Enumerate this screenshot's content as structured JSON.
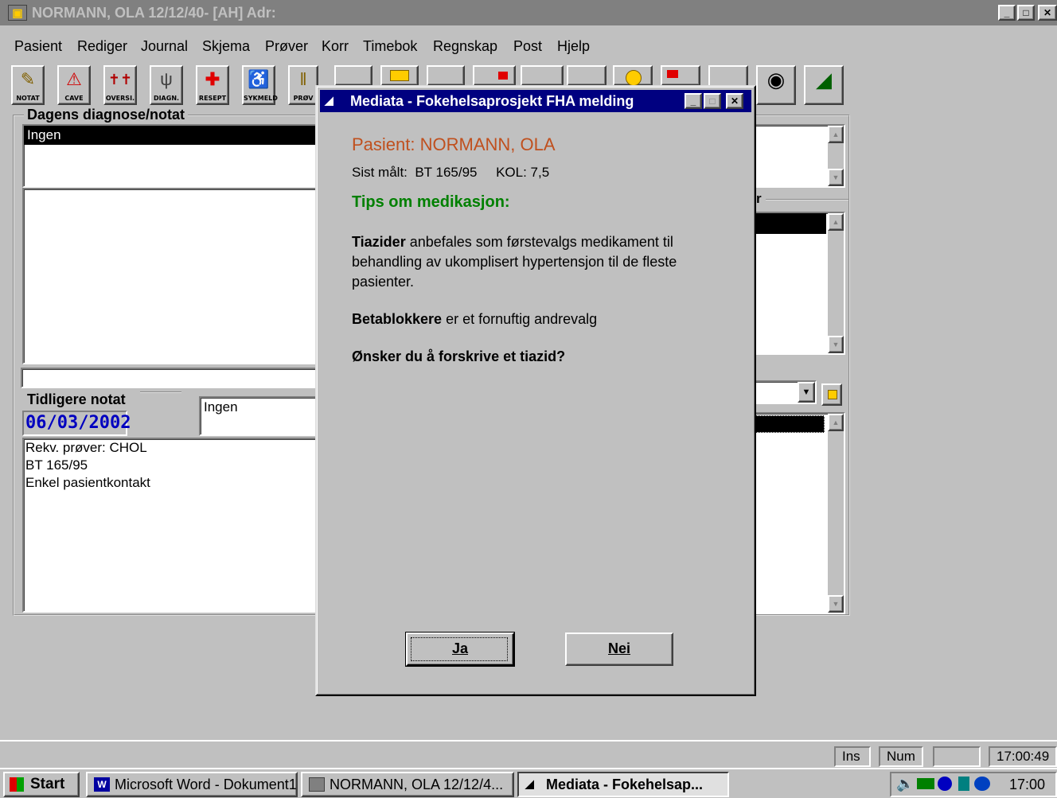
{
  "main_window": {
    "title": "NORMANN, OLA 12/12/40- [AH] Adr:",
    "controls": [
      "_",
      "□",
      "✕"
    ]
  },
  "menu": {
    "items": [
      "Pasient",
      "Rediger",
      "Journal",
      "Skjema",
      "Prøver",
      "Korr",
      "Timebok",
      "Regnskap",
      "Post",
      "Hjelp"
    ]
  },
  "toolbar": {
    "buttons": [
      {
        "label": "NOTAT",
        "icon": "notepad-icon"
      },
      {
        "label": "CAVE",
        "icon": "warning-icon"
      },
      {
        "label": "OVERSI.",
        "icon": "people-icon"
      },
      {
        "label": "DIAGN.",
        "icon": "stethoscope-icon"
      },
      {
        "label": "RESEPT",
        "icon": "red-cross-icon"
      },
      {
        "label": "SYKMELD",
        "icon": "wheelchair-icon"
      },
      {
        "label": "PRØV",
        "icon": "test-tubes-icon"
      }
    ]
  },
  "diagnosis_panel": {
    "legend": "Dagens diagnose/notat",
    "selected_value": "Ingen"
  },
  "previous_note": {
    "legend": "Tidligere notat",
    "date": "06/03/2002",
    "diagnosis": "Ingen",
    "lines": [
      "Rekv. prøver: CHOL",
      "BT 165/95",
      "Enkel pasientkontakt"
    ]
  },
  "right_panel": {
    "partial_label": "r"
  },
  "dialog": {
    "title": "Mediata - Fokehelsaprosjekt FHA melding",
    "patient_prefix": "Pasient:",
    "patient_name": "NORMANN, OLA",
    "last_measured": "Sist målt:  BT 165/95     KOL: 7,5",
    "tips_heading": "Tips om medikasjon:",
    "para1_bold": "Tiazider",
    "para1_rest": " anbefales som førstevalgs medikament til behandling av ukomplisert hypertensjon til de fleste pasienter.",
    "para2_bold": "Betablokkere",
    "para2_rest": " er et fornuftig andrevalg",
    "question": "Ønsker du å forskrive et tiazid?",
    "yes_label": "Ja",
    "no_label": "Nei",
    "colors": {
      "title_bar": "#000080",
      "patient": "#c0501e",
      "tips": "#008000"
    }
  },
  "statusbar": {
    "ins": "Ins",
    "num": "Num",
    "empty": "",
    "time": "17:00:49"
  },
  "taskbar": {
    "start": "Start",
    "tasks": [
      {
        "label": "Microsoft Word - Dokument1",
        "active": false
      },
      {
        "label": "NORMANN, OLA 12/12/4...",
        "active": false
      },
      {
        "label": "Mediata - Fokehelsap...",
        "active": true
      }
    ],
    "clock": "17:00"
  }
}
